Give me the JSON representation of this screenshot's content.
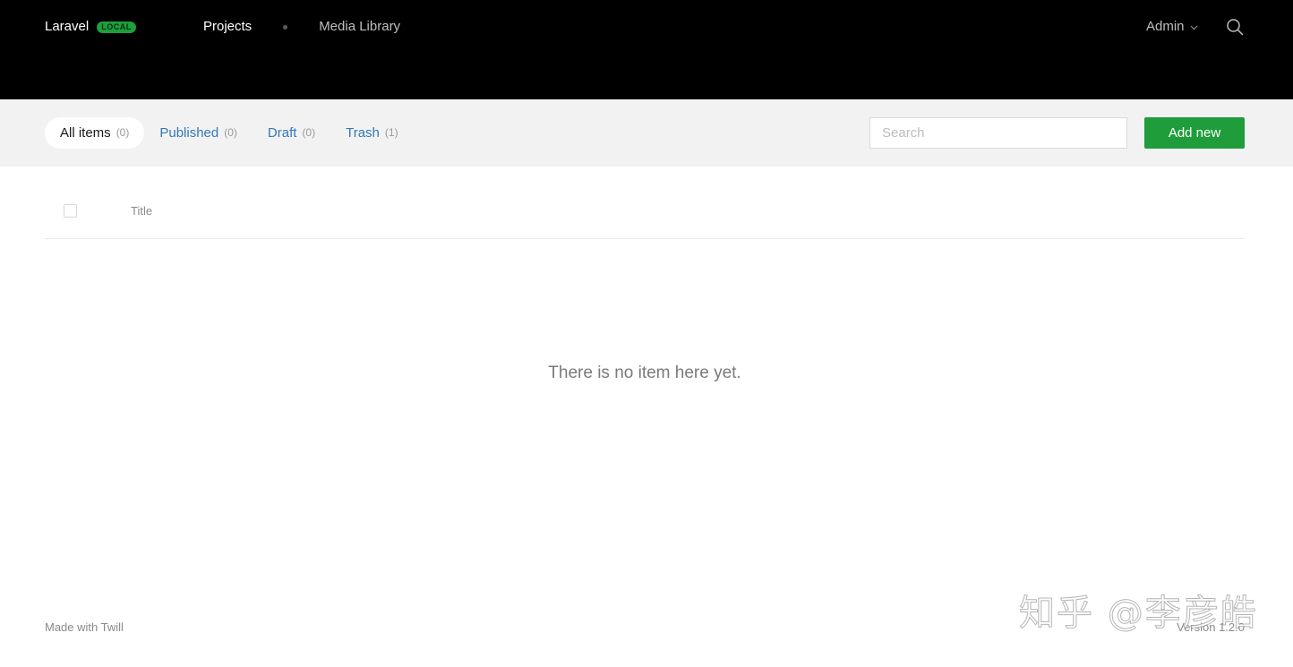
{
  "header": {
    "brand": "Laravel",
    "env_badge": "LOCAL",
    "nav": [
      {
        "label": "Projects",
        "active": true
      },
      {
        "label": "Media Library",
        "active": false
      }
    ],
    "user": "Admin",
    "icons": {
      "user_menu": "chevron-down-icon",
      "search": "search-icon"
    }
  },
  "filters": {
    "tabs": [
      {
        "label": "All items",
        "count": "(0)",
        "selected": true
      },
      {
        "label": "Published",
        "count": "(0)",
        "selected": false
      },
      {
        "label": "Draft",
        "count": "(0)",
        "selected": false
      },
      {
        "label": "Trash",
        "count": "(1)",
        "selected": false
      }
    ],
    "search_placeholder": "Search",
    "add_button": "Add new"
  },
  "table": {
    "columns": [
      "Title"
    ],
    "empty_message": "There is no item here yet."
  },
  "footer": {
    "left": "Made with Twill",
    "version": "Version 1.2.0"
  },
  "watermark": "知乎 @李彦皓",
  "colors": {
    "topbar": "#000000",
    "filterbar": "#f2f2f2",
    "accent_green": "#1e9d3a",
    "link_blue": "#3278b8"
  }
}
